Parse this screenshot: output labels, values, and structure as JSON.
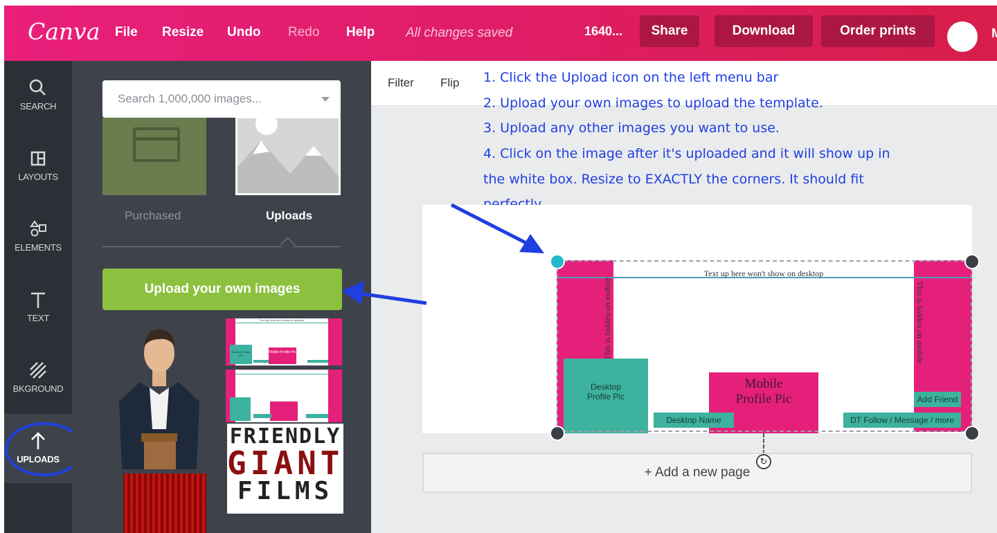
{
  "topbar": {
    "logo": "Canva",
    "menu": {
      "file": "File",
      "resize": "Resize",
      "undo": "Undo",
      "redo": "Redo",
      "help": "Help"
    },
    "status": "All changes saved",
    "dimensions": "1640...",
    "share": "Share",
    "download": "Download",
    "order_prints": "Order prints",
    "user_initial": "M"
  },
  "rail": {
    "search": "SEARCH",
    "layouts": "LAYOUTS",
    "elements": "ELEMENTS",
    "text": "TEXT",
    "background": "BKGROUND",
    "uploads": "UPLOADS"
  },
  "panel": {
    "search_placeholder": "Search 1,000,000 images...",
    "tab_purchased": "Purchased",
    "tab_uploads": "Uploads",
    "upload_button": "Upload your own images",
    "film_logo": {
      "line1": "FRIENDLY",
      "line2": "GIANT",
      "line3": "FILMS"
    },
    "thumb_design": {
      "caption": "Text up here won't show on desktop",
      "desktop_pic": "Desktop Profile Pic",
      "mobile_pic": "Mobile Profile Pic"
    }
  },
  "toolbar": {
    "filter": "Filter",
    "flip": "Flip"
  },
  "instructions": [
    "1.  Click the Upload icon on the left menu bar",
    "2.  Upload your own images to upload the template.",
    "3.  Upload any other images you want to use.",
    "4.  Click on the image after it's uploaded and it will show up in",
    "the white box.  Resize to EXACTLY the corners.  It should fit",
    "perfectly."
  ],
  "design": {
    "top_text": "Text up here won't show on desktop",
    "left_hidden": "This is hidden on mobile",
    "right_hidden": "This is hidden on mobile",
    "desktop_pic_line1": "Desktop",
    "desktop_pic_line2": "Profile Pic",
    "mobile_pic_line1": "Mobile",
    "mobile_pic_line2": "Profile Pic",
    "desktop_name": "Desktop Name",
    "add_friend": "Add Friend",
    "follow": "DT Follow / Message / more"
  },
  "add_page": "+ Add a new page",
  "colors": {
    "brand_pink": "#e5207b",
    "teal": "#3db29e",
    "green_button": "#8cc13f",
    "annotation_blue": "#1f3fe0"
  }
}
